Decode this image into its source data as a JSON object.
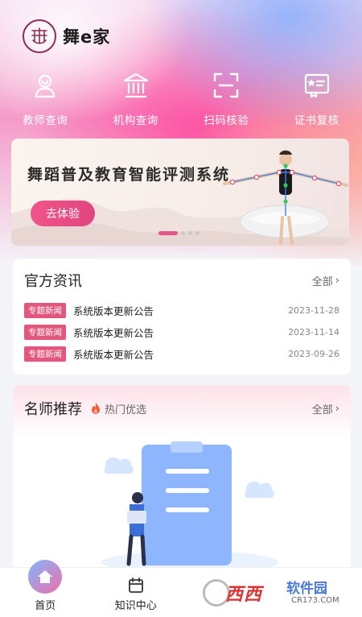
{
  "app": {
    "brand": "舞e家",
    "logo_icon": "dance-seal-logo"
  },
  "quick_nav": [
    {
      "label": "教师查询",
      "icon": "teacher-icon"
    },
    {
      "label": "机构查询",
      "icon": "institution-icon"
    },
    {
      "label": "扫码核验",
      "icon": "scan-icon"
    },
    {
      "label": "证书复核",
      "icon": "certificate-icon"
    }
  ],
  "banner": {
    "title": "舞蹈普及教育智能评测系统",
    "button_label": "去体验",
    "slide_count": 4,
    "active_slide": 1
  },
  "news": {
    "title": "官方资讯",
    "more_label": "全部",
    "items": [
      {
        "tag": "专题新闻",
        "title": "系统版本更新公告",
        "date": "2023-11-28"
      },
      {
        "tag": "专题新闻",
        "title": "系统版本更新公告",
        "date": "2023-11-14"
      },
      {
        "tag": "专题新闻",
        "title": "系统版本更新公告",
        "date": "2023-09-26"
      }
    ]
  },
  "teachers": {
    "title": "名师推荐",
    "hot_label": "热门优选",
    "more_label": "全部"
  },
  "tabbar": [
    {
      "label": "首页",
      "icon": "home-icon",
      "active": true
    },
    {
      "label": "知识中心",
      "icon": "calendar-icon",
      "active": false
    }
  ],
  "watermark": {
    "main": "西西",
    "sub": "软件园",
    "url": "CR173.COM"
  },
  "colors": {
    "accent": "#e3567e",
    "button": "#f0548a"
  }
}
